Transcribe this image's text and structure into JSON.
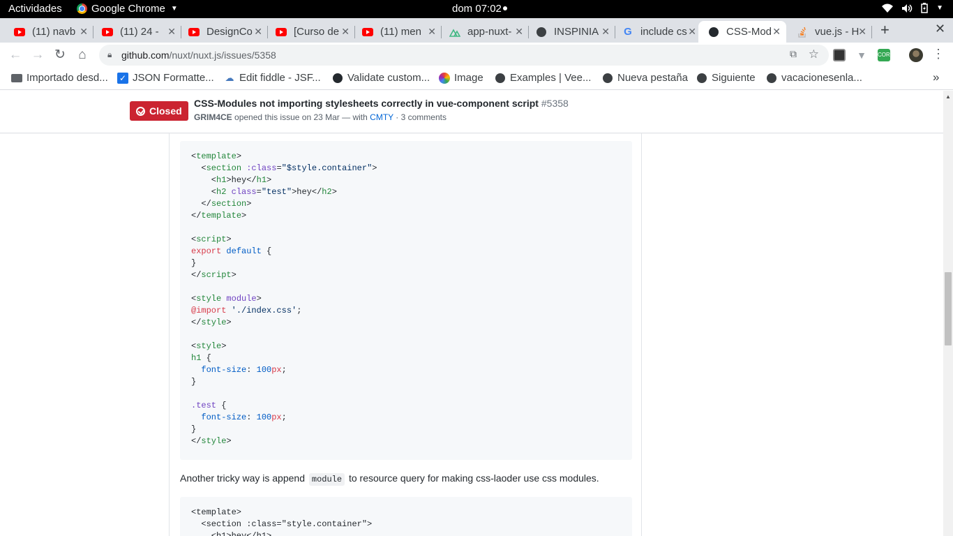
{
  "os": {
    "activities": "Actividades",
    "app_name": "Google Chrome",
    "clock": "dom 07:02"
  },
  "tabs": [
    {
      "title": "(11) navb",
      "icon": "youtube-icon"
    },
    {
      "title": "(11) 24 -",
      "icon": "youtube-icon"
    },
    {
      "title": "DesignCo",
      "icon": "youtube-icon"
    },
    {
      "title": "[Curso de",
      "icon": "youtube-icon"
    },
    {
      "title": "(11) men",
      "icon": "youtube-icon"
    },
    {
      "title": "app-nuxt-",
      "icon": "nuxt-icon"
    },
    {
      "title": "INSPINIA",
      "icon": "globe-icon"
    },
    {
      "title": "include cs",
      "icon": "google-icon"
    },
    {
      "title": "CSS-Mod",
      "icon": "github-icon"
    },
    {
      "title": "vue.js - H",
      "icon": "stackoverflow-icon"
    }
  ],
  "address_bar": {
    "host": "github.com",
    "path": "/nuxt/nuxt.js/issues/5358"
  },
  "bookmarks": [
    {
      "label": "Importado desd...",
      "icon": "folder-icon"
    },
    {
      "label": "JSON Formatte...",
      "icon": "checkbox-icon"
    },
    {
      "label": "Edit fiddle - JSF...",
      "icon": "jsfiddle-icon"
    },
    {
      "label": "Validate custom...",
      "icon": "github-icon"
    },
    {
      "label": "Image",
      "icon": "color-wheel-icon"
    },
    {
      "label": "Examples | Vee...",
      "icon": "globe-icon"
    },
    {
      "label": "Nueva pestaña",
      "icon": "globe-icon"
    },
    {
      "label": "Siguiente",
      "icon": "globe-icon"
    },
    {
      "label": "vacacionesenla...",
      "icon": "globe-icon"
    }
  ],
  "issue": {
    "state": "Closed",
    "title": "CSS-Modules not importing stylesheets correctly in vue-component script",
    "number": "#5358",
    "author": "GRIM4CE",
    "opened_text": "opened this issue on 23 Mar — with",
    "via": "CMTY",
    "comments": "· 3 comments",
    "state_color": "#cb2431"
  },
  "comment": {
    "prose_before": "Another tricky way is append",
    "inline_code": "module",
    "prose_after": "to resource query for making css-laoder use css modules."
  }
}
